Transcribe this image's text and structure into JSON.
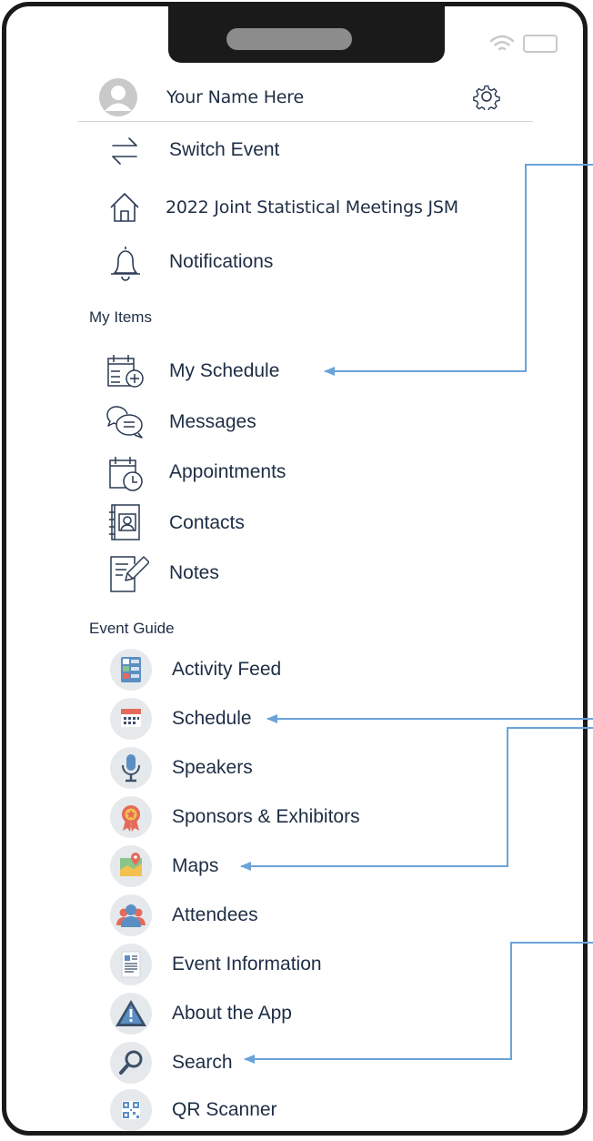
{
  "profile": {
    "name": "Your Name Here"
  },
  "menu": {
    "switch_event": "Switch Event",
    "event_name": "2022 Joint Statistical Meetings JSM",
    "notifications": "Notifications"
  },
  "my_items": {
    "heading": "My Items",
    "items": [
      "My Schedule",
      "Messages",
      "Appointments",
      "Contacts",
      "Notes"
    ]
  },
  "event_guide": {
    "heading": "Event Guide",
    "items": [
      "Activity Feed",
      "Schedule",
      "Speakers",
      "Sponsors & Exhibitors",
      "Maps",
      "Attendees",
      "Event Information",
      "About the App",
      "Search",
      "QR Scanner"
    ]
  },
  "colors": {
    "annotation_line": "#6aa3d8",
    "text": "#1e2d44",
    "icon_stroke": "#2a3a52"
  },
  "icons": [
    "avatar-icon",
    "gear-icon",
    "switch-arrows-icon",
    "home-icon",
    "bell-icon",
    "calendar-add-icon",
    "chat-bubbles-icon",
    "calendar-clock-icon",
    "contact-book-icon",
    "notes-pencil-icon",
    "activity-feed-icon",
    "calendar-icon",
    "microphone-icon",
    "ribbon-award-icon",
    "map-pin-icon",
    "attendees-icon",
    "document-icon",
    "warning-triangle-icon",
    "magnifier-icon",
    "qr-code-icon"
  ]
}
